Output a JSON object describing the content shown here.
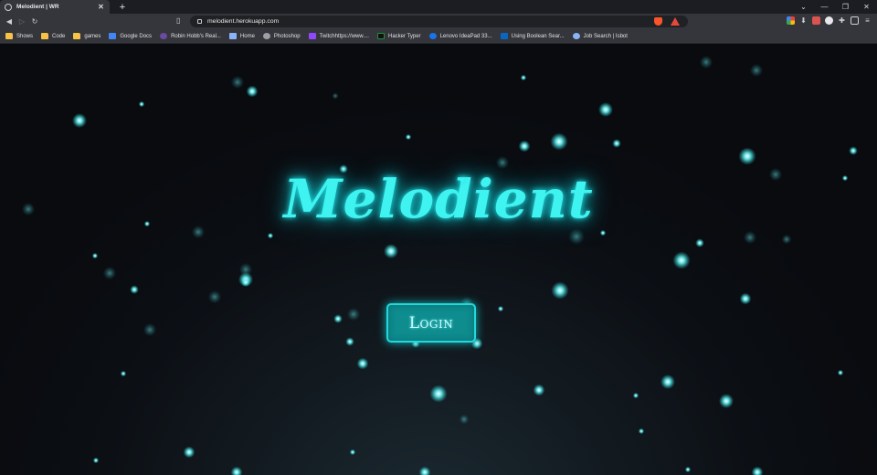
{
  "browser": {
    "tab": {
      "title": "Melodient | WR"
    },
    "new_tab_symbol": "+",
    "window_controls": [
      "⌄",
      "—",
      "❐",
      "✕"
    ],
    "address": {
      "url": "melodient.herokuapp.com"
    },
    "bookmarks": [
      {
        "label": "Shows",
        "icon": "folder-icon",
        "color": "#f6c344"
      },
      {
        "label": "Code",
        "icon": "folder-icon",
        "color": "#f6c344"
      },
      {
        "label": "games",
        "icon": "folder-icon",
        "color": "#f6c344"
      },
      {
        "label": "Google Docs",
        "icon": "docs-icon",
        "color": "#4285f4"
      },
      {
        "label": "Robin Hobb's Real...",
        "icon": "site-icon",
        "color": "#6b4aa0"
      },
      {
        "label": "Home",
        "icon": "home-site-icon",
        "color": "#8ab4f8"
      },
      {
        "label": "Photoshop",
        "icon": "globe-icon",
        "color": "#9aa0a6"
      },
      {
        "label": "Twitchhttps://www....",
        "icon": "twitch-icon",
        "color": "#9146ff"
      },
      {
        "label": "Hacker Typer",
        "icon": "terminal-icon",
        "color": "#1e8e3e"
      },
      {
        "label": "Lenovo IdeaPad 33...",
        "icon": "lenovo-icon",
        "color": "#1a73e8"
      },
      {
        "label": "Using Boolean Sear...",
        "icon": "linkedin-icon",
        "color": "#0a66c2"
      },
      {
        "label": "Job Search | Isbot",
        "icon": "isbot-icon",
        "color": "#8ab4f8"
      }
    ]
  },
  "page": {
    "logo_text": "Melodient",
    "login_label": "Login",
    "accent": "#3ff3f0"
  }
}
